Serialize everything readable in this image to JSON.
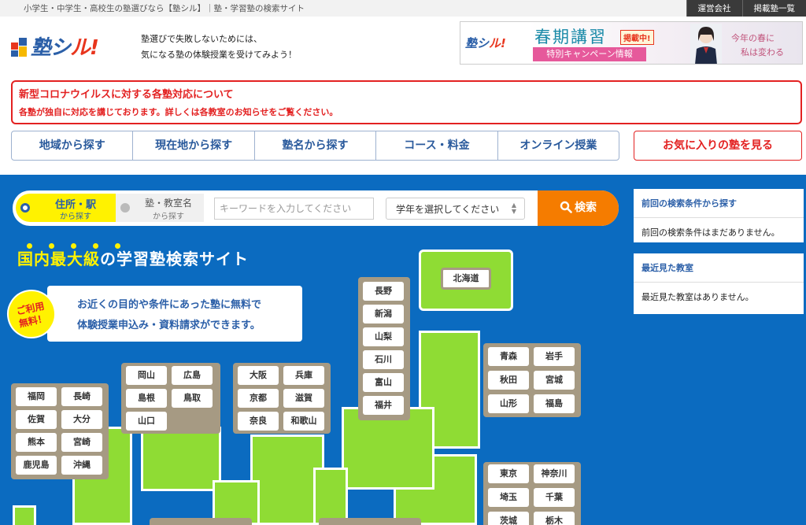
{
  "topbar": {
    "tagline": "小学生・中学生・高校生の塾選びなら【塾シル】｜塾・学習塾の検索サイト",
    "links": [
      "運営会社",
      "掲載塾一覧"
    ]
  },
  "header": {
    "logo_text_a": "塾シ",
    "logo_text_b": "ル!",
    "desc_line1": "塾選びで失敗しないためには、",
    "desc_line2": "気になる塾の体験授業を受けてみよう！"
  },
  "banner": {
    "logo_a": "塾シ",
    "logo_b": "ル!",
    "title": "春期講習",
    "badge": "掲載中!",
    "sub": "特別キャンペーン情報",
    "right1": "今年の春に",
    "right2": "私は変わる"
  },
  "notice": {
    "title": "新型コロナウイルスに対する各塾対応について",
    "body": "各塾が独自に対応を講じております。詳しくは各教室のお知らせをご覧ください。"
  },
  "nav": {
    "items": [
      "地域から探す",
      "現在地から探す",
      "塾名から探す",
      "コース・料金",
      "オンライン授業"
    ],
    "favorite": "お気に入りの塾を見る"
  },
  "search": {
    "mode1_line1": "住所・駅",
    "mode1_line2": "から探す",
    "mode2_line1": "塾・教室名",
    "mode2_line2": "から探す",
    "keyword_placeholder": "キーワードを入力してください",
    "grade_selected": "学年を選択してください",
    "button": "検索"
  },
  "hero": {
    "headline_a": "国内",
    "headline_b": "最大級",
    "headline_c": "の学習塾検索サイト",
    "badge": "ご利用無料！",
    "badge_line1": "ご利用",
    "badge_line2": "無料！",
    "line1": "お近くの目的や条件にあった塾に無料で",
    "line2": "体験授業申込み・資料請求ができます。"
  },
  "map": {
    "hokkaido": "北海道",
    "kyushu": [
      "福岡",
      "長崎",
      "佐賀",
      "大分",
      "熊本",
      "宮崎",
      "鹿児島",
      "沖縄"
    ],
    "chugoku": [
      "岡山",
      "広島",
      "島根",
      "鳥取",
      "山口"
    ],
    "kinki": [
      "大阪",
      "兵庫",
      "京都",
      "滋賀",
      "奈良",
      "和歌山"
    ],
    "chubu": [
      "長野",
      "新潟",
      "山梨",
      "石川",
      "富山",
      "福井"
    ],
    "tohoku": [
      "青森",
      "岩手",
      "秋田",
      "宮城",
      "山形",
      "福島"
    ],
    "kanto": [
      "東京",
      "神奈川",
      "埼玉",
      "千葉",
      "茨城",
      "栃木"
    ]
  },
  "side": {
    "prev_title": "前回の検索条件から探す",
    "prev_body": "前回の検索条件はまだありません。",
    "recent_title": "最近見た教室",
    "recent_body": "最近見た教室はありません。"
  },
  "colors": {
    "brand_blue": "#2b5fa8",
    "accent_red": "#e32121",
    "main_bg": "#0b6bc0",
    "land": "#8fdc34",
    "search_orange": "#f57c00"
  }
}
